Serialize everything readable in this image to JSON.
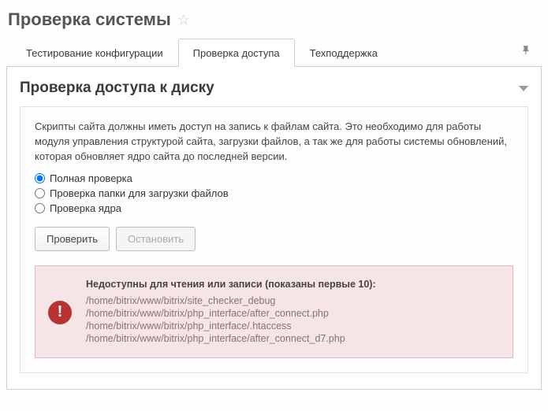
{
  "header": {
    "title": "Проверка системы"
  },
  "tabs": [
    {
      "label": "Тестирование конфигурации",
      "active": false
    },
    {
      "label": "Проверка доступа",
      "active": true
    },
    {
      "label": "Техподдержка",
      "active": false
    }
  ],
  "section": {
    "title": "Проверка доступа к диску",
    "description": "Скрипты сайта должны иметь доступ на запись к файлам сайта. Это необходимо для работы модуля управления структурой сайта, загрузки файлов, а так же для работы системы обновлений, которая обновляет ядро сайта до последней версии."
  },
  "options": [
    {
      "label": "Полная проверка",
      "checked": true
    },
    {
      "label": "Проверка папки для загрузки файлов",
      "checked": false
    },
    {
      "label": "Проверка ядра",
      "checked": false
    }
  ],
  "buttons": {
    "check": "Проверить",
    "stop": "Остановить"
  },
  "error": {
    "title": "Недоступны для чтения или записи (показаны первые 10):",
    "lines": [
      "/home/bitrix/www/bitrix/site_checker_debug",
      "/home/bitrix/www/bitrix/php_interface/after_connect.php",
      "/home/bitrix/www/bitrix/php_interface/.htaccess",
      "/home/bitrix/www/bitrix/php_interface/after_connect_d7.php"
    ]
  }
}
